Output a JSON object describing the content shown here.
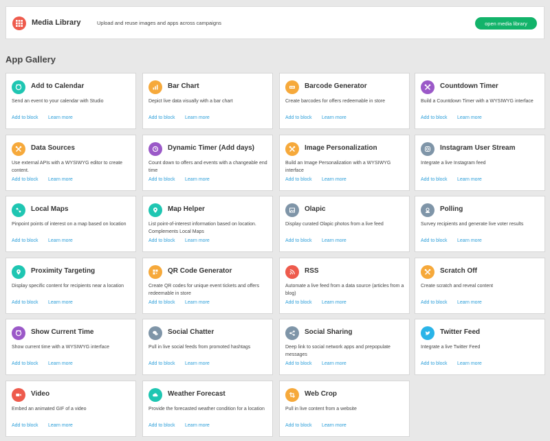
{
  "media_library": {
    "title": "Media Library",
    "description": "Upload and reuse images and apps across campaigns",
    "button_label": "open media library",
    "icon": "grid-icon",
    "icon_color": "#ee5b4d",
    "button_color": "#12b36a"
  },
  "gallery": {
    "title": "App Gallery",
    "add_label": "Add to block",
    "learn_label": "Learn more",
    "apps": [
      {
        "title": "Add to Calendar",
        "description": "Send an event to your calendar with Studio",
        "icon": "calendar-icon",
        "color": "#1fc6b2"
      },
      {
        "title": "Bar Chart",
        "description": "Depict live data visually with a bar chart",
        "icon": "bar-chart-icon",
        "color": "#f6a93b"
      },
      {
        "title": "Barcode Generator",
        "description": "Create barcodes for offers redeemable in store",
        "icon": "barcode-icon",
        "color": "#f6a93b"
      },
      {
        "title": "Countdown Timer",
        "description": "Build a Countdown Timer with a WYSIWYG interface",
        "icon": "tools-icon",
        "color": "#9b59c8"
      },
      {
        "title": "Data Sources",
        "description": "Use external APIs with a WYSIWYG editor to create content.",
        "icon": "tools-icon",
        "color": "#f6a93b"
      },
      {
        "title": "Dynamic Timer (Add days)",
        "description": "Count down to offers and events with a changeable end time",
        "icon": "timer-icon",
        "color": "#9b59c8"
      },
      {
        "title": "Image Personalization",
        "description": "Build an Image Personalization with a WYSIWYG interface",
        "icon": "tools-icon",
        "color": "#f6a93b"
      },
      {
        "title": "Instagram User Stream",
        "description": "Integrate a live Instagram feed",
        "icon": "instagram-icon",
        "color": "#7f95a8"
      },
      {
        "title": "Local Maps",
        "description": "Pinpoint points of interest on a map based on location",
        "icon": "map-icon",
        "color": "#1fc6b2"
      },
      {
        "title": "Map Helper",
        "description": "List point-of-interest information based on location. Complements Local Maps",
        "icon": "map-pin-icon",
        "color": "#1fc6b2"
      },
      {
        "title": "Olapic",
        "description": "Display curated Olapic photos from a live feed",
        "icon": "image-icon",
        "color": "#7f95a8"
      },
      {
        "title": "Polling",
        "description": "Survey recipients and generate live voter results",
        "icon": "poll-icon",
        "color": "#7f95a8"
      },
      {
        "title": "Proximity Targeting",
        "description": "Display specific content for recipients near a location",
        "icon": "location-icon",
        "color": "#1fc6b2"
      },
      {
        "title": "QR Code Generator",
        "description": "Create QR codes for unique event tickets and offers redeemable in store",
        "icon": "qr-code-icon",
        "color": "#f6a93b"
      },
      {
        "title": "RSS",
        "description": "Automate a live feed from a data source (articles from a blog)",
        "icon": "rss-icon",
        "color": "#ee5b4d"
      },
      {
        "title": "Scratch Off",
        "description": "Create scratch and reveal content",
        "icon": "tools-icon",
        "color": "#f6a93b"
      },
      {
        "title": "Show Current Time",
        "description": "Show current time with a WYSIWYG interface",
        "icon": "clock-icon",
        "color": "#9b59c8"
      },
      {
        "title": "Social Chatter",
        "description": "Pull in live social feeds from promoted hashtags",
        "icon": "chat-icon",
        "color": "#7f95a8"
      },
      {
        "title": "Social Sharing",
        "description": "Deep link to social network apps and prepopulate messages",
        "icon": "share-icon",
        "color": "#7f95a8"
      },
      {
        "title": "Twitter Feed",
        "description": "Integrate a live Twitter Feed",
        "icon": "twitter-icon",
        "color": "#2ab4e8"
      },
      {
        "title": "Video",
        "description": "Embed an animated GIF of a video",
        "icon": "video-icon",
        "color": "#ee5b4d"
      },
      {
        "title": "Weather Forecast",
        "description": "Provide the forecasted weather condition for a location",
        "icon": "weather-icon",
        "color": "#1fc6b2"
      },
      {
        "title": "Web Crop",
        "description": "Pull in live content from a website",
        "icon": "crop-icon",
        "color": "#f6a93b"
      }
    ]
  }
}
